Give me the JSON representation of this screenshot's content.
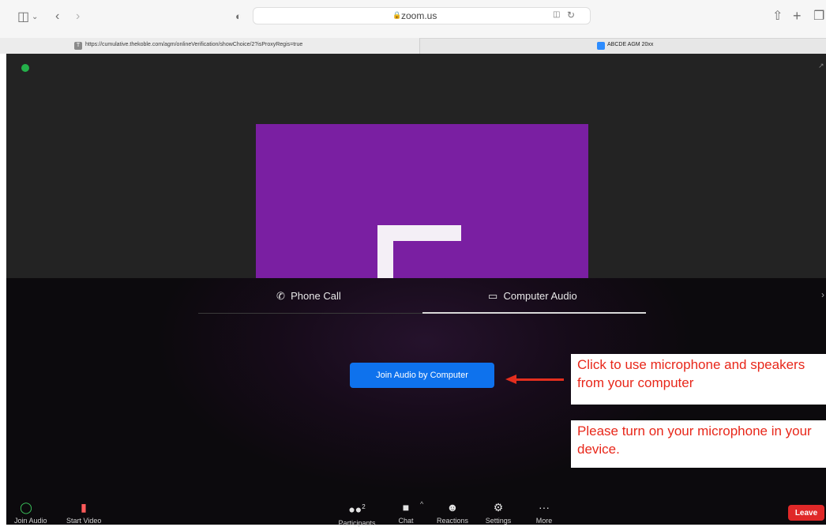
{
  "browser": {
    "address": "zoom.us",
    "tabs": [
      {
        "label": "https://cumulative.thekoble.com/agm/onlineVerification/showChoice/2?isProxyRegis=true",
        "favicon": "T"
      },
      {
        "label": "ABCDE AGM 20xx",
        "favicon": "zoom-icon"
      }
    ]
  },
  "audio_dialog": {
    "tabs": [
      {
        "label": "Phone Call",
        "icon": "phone-icon"
      },
      {
        "label": "Computer Audio",
        "icon": "computer-icon"
      }
    ],
    "join_button": "Join Audio by Computer"
  },
  "annotations": {
    "note1": "Click to use microphone and speakers from your computer",
    "note2": "Please turn on your microphone in your device."
  },
  "toolbar": {
    "left": [
      {
        "label": "Join Audio",
        "icon": "headphones-icon"
      },
      {
        "label": "Start Video",
        "icon": "video-off-icon"
      }
    ],
    "center": [
      {
        "label": "Participants",
        "icon": "participants-icon",
        "badge": "2"
      },
      {
        "label": "Chat",
        "icon": "chat-icon"
      },
      {
        "label": "Reactions",
        "icon": "reactions-icon"
      },
      {
        "label": "Settings",
        "icon": "gear-icon"
      },
      {
        "label": "More",
        "icon": "more-icon"
      }
    ],
    "leave": "Leave"
  },
  "colors": {
    "accent": "#0e72ed",
    "leave": "#e02828",
    "share_background": "#7a1fa2",
    "annotation_text": "#e8271a"
  }
}
